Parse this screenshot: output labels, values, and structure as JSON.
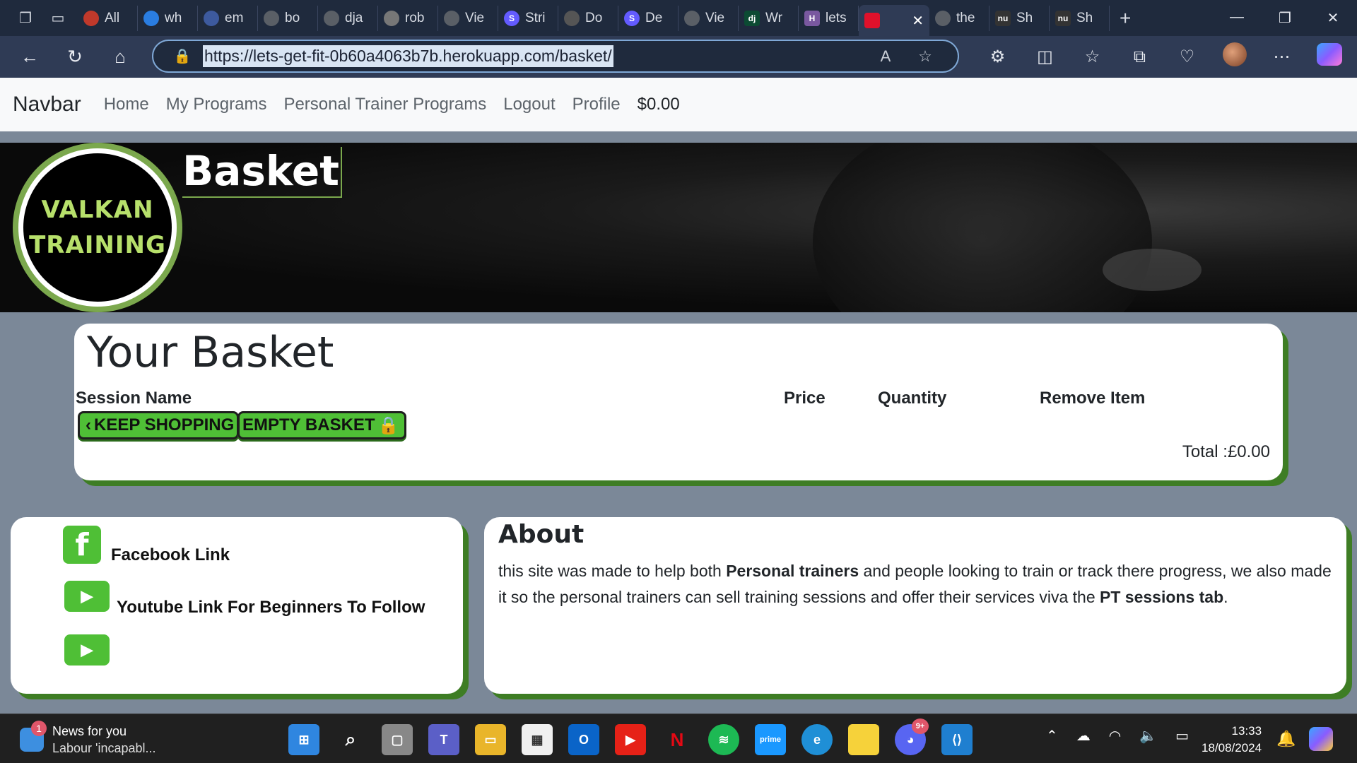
{
  "browser": {
    "tabs": [
      {
        "label": "All",
        "color": "#c0392b"
      },
      {
        "label": "wh",
        "color": "#2a7de1"
      },
      {
        "label": "em",
        "color": "#3d5a9e"
      },
      {
        "label": "bo",
        "color": "#24292e"
      },
      {
        "label": "dja",
        "color": "#24292e"
      },
      {
        "label": "rob",
        "color": "#666666"
      },
      {
        "label": "Vie",
        "color": "#24292e"
      },
      {
        "label": "Stri",
        "color": "#635bff"
      },
      {
        "label": "Do",
        "color": "#555555"
      },
      {
        "label": "De",
        "color": "#635bff"
      },
      {
        "label": "Vie",
        "color": "#24292e"
      },
      {
        "label": "Wr",
        "color": "#0c4b33"
      },
      {
        "label": "lets",
        "color": "#79589f"
      }
    ],
    "active_tab_color": "#e0112b",
    "after_tabs": [
      {
        "label": "the",
        "color": "#24292e"
      },
      {
        "label": "Sh",
        "color": "#222222"
      },
      {
        "label": "Sh",
        "color": "#222222"
      }
    ],
    "url": "https://lets-get-fit-0b60a4063b7b.herokuapp.com/basket/"
  },
  "navbar": {
    "brand": "Navbar",
    "links": [
      "Home",
      "My Programs",
      "Personal Trainer Programs",
      "Logout",
      "Profile"
    ],
    "total": "$0.00"
  },
  "hero": {
    "logo_line1": "VALKAN",
    "logo_line2": "TRAINING",
    "title": "Basket"
  },
  "basket": {
    "title": "Your Basket",
    "columns": [
      "Session Name",
      "Price",
      "Quantity",
      "Remove Item"
    ],
    "keep_shopping": "KEEP SHOPPING",
    "empty_basket": "EMPTY BASKET",
    "total": "Total :£0.00"
  },
  "links": {
    "facebook": "Facebook Link",
    "youtube": "Youtube Link For Beginners To Follow"
  },
  "about": {
    "title": "About",
    "text_1": "this site was made to help both ",
    "bold_1": "Personal trainers",
    "text_2": " and people looking to train or track there progress, we also made it so the personal trainers can sell training sessions and offer their services viva the ",
    "bold_2": "PT sessions tab",
    "text_3": "."
  },
  "taskbar": {
    "news_title": "News for you",
    "news_sub": "Labour 'incapabl...",
    "news_badge": "1",
    "discord_badge": "9+",
    "time": "13:33",
    "date": "18/08/2024"
  },
  "colors": {
    "accent_green": "#4fbf36",
    "shadow_green": "#3e7d24",
    "page_bg": "#7b8898"
  }
}
